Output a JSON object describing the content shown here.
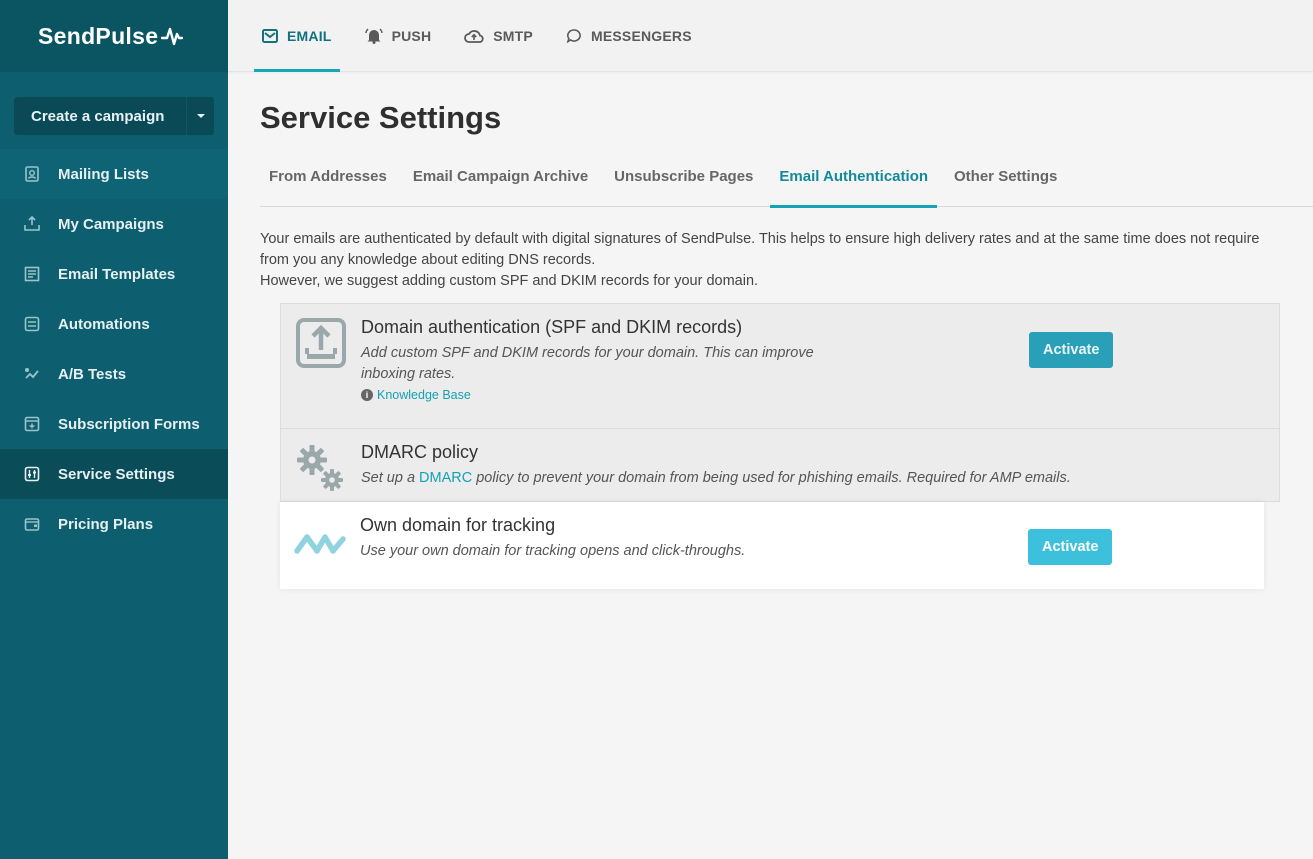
{
  "brand": {
    "name": "SendPulse"
  },
  "sidebar": {
    "create_label": "Create a campaign",
    "items": [
      {
        "label": "Mailing Lists",
        "icon": "address-book-icon"
      },
      {
        "label": "My Campaigns",
        "icon": "upload-icon"
      },
      {
        "label": "Email Templates",
        "icon": "template-icon"
      },
      {
        "label": "Automations",
        "icon": "automation-icon"
      },
      {
        "label": "A/B Tests",
        "icon": "ab-test-icon"
      },
      {
        "label": "Subscription Forms",
        "icon": "form-icon"
      },
      {
        "label": "Service Settings",
        "icon": "settings-sliders-icon"
      },
      {
        "label": "Pricing Plans",
        "icon": "wallet-icon"
      }
    ]
  },
  "topnav": {
    "items": [
      {
        "label": "EMAIL",
        "icon": "envelope-icon",
        "active": true
      },
      {
        "label": "PUSH",
        "icon": "bell-icon"
      },
      {
        "label": "SMTP",
        "icon": "cloud-upload-icon"
      },
      {
        "label": "MESSENGERS",
        "icon": "chat-bubble-icon"
      }
    ]
  },
  "main": {
    "title": "Service Settings",
    "tabs": [
      {
        "label": "From Addresses"
      },
      {
        "label": "Email Campaign Archive"
      },
      {
        "label": "Unsubscribe Pages"
      },
      {
        "label": "Email Authentication",
        "active": true
      },
      {
        "label": "Other Settings"
      }
    ],
    "intro_line1": "Your emails are authenticated by default with digital signatures of SendPulse. This helps to ensure high delivery rates and at the same time does not require from you any knowledge about editing DNS records.",
    "intro_line2": "However, we suggest adding custom SPF and DKIM records for your domain.",
    "cards": [
      {
        "title": "Domain authentication (SPF and DKIM records)",
        "desc": "Add custom SPF and DKIM records for your domain. This can improve inboxing rates.",
        "kb_label": "Knowledge Base",
        "button": "Activate",
        "icon": "upload-box-icon"
      },
      {
        "title": "DMARC policy",
        "desc_before": "Set up a ",
        "desc_link": "DMARC",
        "desc_after": " policy to prevent your domain from being used for phishing emails. Required for AMP emails.",
        "icon": "gears-icon"
      },
      {
        "title": "Own domain for tracking",
        "desc": "Use your own domain for tracking opens and click-throughs.",
        "button": "Activate",
        "icon": "pulse-wave-icon"
      }
    ]
  },
  "colors": {
    "sidebar": "#0d5f6f",
    "accent": "#15a2b4",
    "button": "#2aa0b8"
  }
}
